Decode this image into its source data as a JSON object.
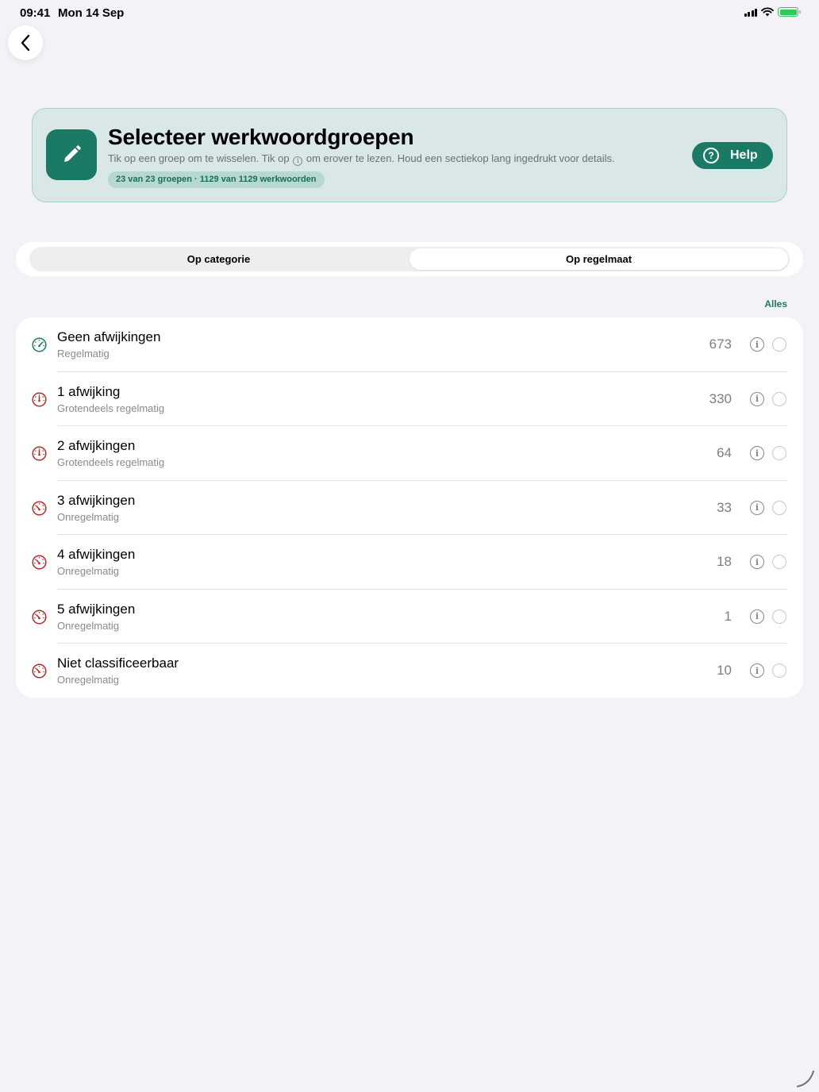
{
  "status": {
    "time": "09:41",
    "date": "Mon 14 Sep",
    "battery_color": "#34c759"
  },
  "header": {
    "title": "Selecteer werkwoordgroepen",
    "subtitle_before": "Tik op een groep om te wisselen. Tik op",
    "subtitle_info_glyph": "i",
    "subtitle_after": "om erover te lezen. Houd een sectiekop lang ingedrukt voor details.",
    "badge": "23 van 23 groepen · 1129 van 1129 werkwoorden",
    "help_label": "Help",
    "help_glyph": "?",
    "accent": "#1a7a66",
    "icon": "pencil-icon"
  },
  "segments": {
    "items": [
      "Op categorie",
      "Op regelmaat"
    ],
    "selected": "Op regelmaat"
  },
  "select_all_label": "Alles",
  "rows": [
    {
      "title": "Geen afwijkingen",
      "subtitle": "Regelmatig",
      "count": "673",
      "icon": "gauge-low-icon",
      "icon_color": "#1a7a66",
      "selected": false
    },
    {
      "title": "1 afwijking",
      "subtitle": "Grotendeels regelmatig",
      "count": "330",
      "icon": "gauge-mid-icon",
      "icon_color": "#b22a2a",
      "selected": false
    },
    {
      "title": "2 afwijkingen",
      "subtitle": "Grotendeels regelmatig",
      "count": "64",
      "icon": "gauge-mid-icon",
      "icon_color": "#b22a2a",
      "selected": false
    },
    {
      "title": "3 afwijkingen",
      "subtitle": "Onregelmatig",
      "count": "33",
      "icon": "gauge-high-icon",
      "icon_color": "#b22a2a",
      "selected": false
    },
    {
      "title": "4 afwijkingen",
      "subtitle": "Onregelmatig",
      "count": "18",
      "icon": "gauge-high-icon",
      "icon_color": "#b22a2a",
      "selected": false
    },
    {
      "title": "5 afwijkingen",
      "subtitle": "Onregelmatig",
      "count": "1",
      "icon": "gauge-high-icon",
      "icon_color": "#b22a2a",
      "selected": false
    },
    {
      "title": "Niet classificeerbaar",
      "subtitle": "Onregelmatig",
      "count": "10",
      "icon": "gauge-high-icon",
      "icon_color": "#b22a2a",
      "selected": false
    }
  ],
  "info_glyph": "i"
}
